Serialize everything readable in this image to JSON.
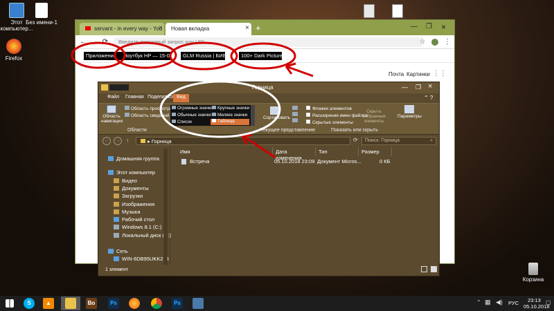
{
  "desktop": {
    "icons": [
      {
        "label": "Этот компьютер..."
      },
      {
        "label": "Без имени-1"
      },
      {
        "label": "Firefox"
      },
      {
        "label": "Корзина"
      }
    ]
  },
  "chrome": {
    "tabs": [
      {
        "title": "servant - in every way - You",
        "close": "×"
      },
      {
        "title": "Новая вкладка",
        "close": "×"
      }
    ],
    "new_tab": "+",
    "address_placeholder": "Введите поисковый запрос или URL",
    "bookmarks": [
      {
        "label": "Приложения"
      },
      {
        "label": "Ноутбук HP — 15-0"
      },
      {
        "label": "GLM Russia | БИБЛ"
      },
      {
        "label": "100+ Dark Pictures |"
      }
    ],
    "links": {
      "mail": "Почта",
      "images": "Картинки"
    }
  },
  "explorer": {
    "title": "Горница",
    "ribbon_tabs": [
      "Файл",
      "Главная",
      "Поделиться",
      "Вид"
    ],
    "active_tab": "Вид",
    "panes": {
      "nav_pane": "Область навигации",
      "preview": "Область просмотра",
      "details": "Область сведений",
      "group_label": "Области"
    },
    "layout_options": [
      "Огромные значки",
      "Крупные значки",
      "Обычные значки",
      "Мелкие значки",
      "Список",
      "Таблица"
    ],
    "layout_selected": "Таблица",
    "sort": {
      "label": "Сортировать",
      "group_label": "Текущее представление"
    },
    "show_hide": {
      "items": [
        "Флажки элементов",
        "Расширения имен файлов",
        "Скрытые элементы"
      ],
      "hide_selected": "Скрыть выбранные элементы",
      "group_label": "Показать или скрыть"
    },
    "options": "Параметры",
    "path": "Горница",
    "search_placeholder": "Поиск: Горница",
    "nav": [
      {
        "label": "Домашняя группа"
      },
      {
        "label": "Этот компьютер"
      },
      {
        "label": "Видео"
      },
      {
        "label": "Документы"
      },
      {
        "label": "Загрузки"
      },
      {
        "label": "Изображения"
      },
      {
        "label": "Музыка"
      },
      {
        "label": "Рабочий стол"
      },
      {
        "label": "Windows 8.1 (C:)"
      },
      {
        "label": "Локальный диск (D:)"
      },
      {
        "label": "Сеть"
      },
      {
        "label": "WIN-6DB95UKK214"
      }
    ],
    "columns": [
      "Имя",
      "Дата изменения",
      "Тип",
      "Размер"
    ],
    "files": [
      {
        "name": "Встреча",
        "date": "05.10.2018 23:09",
        "type": "Документ Micros...",
        "size": "0 КБ"
      }
    ],
    "status": "1 элемент"
  },
  "taskbar": {
    "apps": [
      "Skype",
      "VLC",
      "Explorer",
      "Bo",
      "Photoshop",
      "Firefox",
      "Chrome",
      "Photoshop",
      "Remote"
    ],
    "lang": "РУС",
    "time": "23:13",
    "date": "05.10.2018"
  },
  "annotation_color": "#d00000"
}
